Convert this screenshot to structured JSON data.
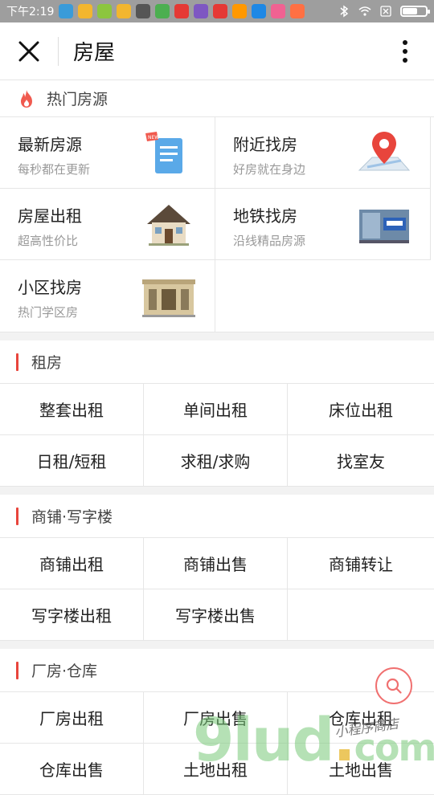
{
  "status_bar": {
    "time": "下午2:19",
    "apps": [
      "app-icon-1",
      "app-icon-2",
      "app-icon-3",
      "app-icon-4",
      "app-icon-5",
      "app-icon-6",
      "app-icon-7",
      "app-icon-8",
      "app-icon-9",
      "app-icon-10",
      "app-icon-11",
      "app-icon-12",
      "app-icon-13",
      "app-icon-14",
      "app-icon-15"
    ]
  },
  "nav": {
    "title": "房屋"
  },
  "hot": {
    "title": "热门房源",
    "items": [
      {
        "name": "最新房源",
        "sub": "每秒都在更新",
        "icon": "document-icon"
      },
      {
        "name": "附近找房",
        "sub": "好房就在身边",
        "icon": "map-pin-icon"
      },
      {
        "name": "房屋出租",
        "sub": "超高性价比",
        "icon": "house-icon"
      },
      {
        "name": "地铁找房",
        "sub": "沿线精品房源",
        "icon": "subway-icon"
      },
      {
        "name": "小区找房",
        "sub": "热门学区房",
        "icon": "building-icon"
      }
    ]
  },
  "sections": [
    {
      "title": "租房",
      "options": [
        "整套出租",
        "单间出租",
        "床位出租",
        "日租/短租",
        "求租/求购",
        "找室友"
      ]
    },
    {
      "title": "商铺·写字楼",
      "options": [
        "商铺出租",
        "商铺出售",
        "商铺转让",
        "写字楼出租",
        "写字楼出售"
      ]
    },
    {
      "title": "厂房·仓库",
      "options": [
        "厂房出租",
        "厂房出售",
        "仓库出租",
        "仓库出售",
        "土地出租",
        "土地出售"
      ]
    }
  ],
  "watermark": {
    "main": "9lud",
    "dot": ".",
    "com": "com",
    "hand": "小程序商店"
  },
  "colors": {
    "accent": "#e8453c",
    "flame": "#f05a4f"
  }
}
